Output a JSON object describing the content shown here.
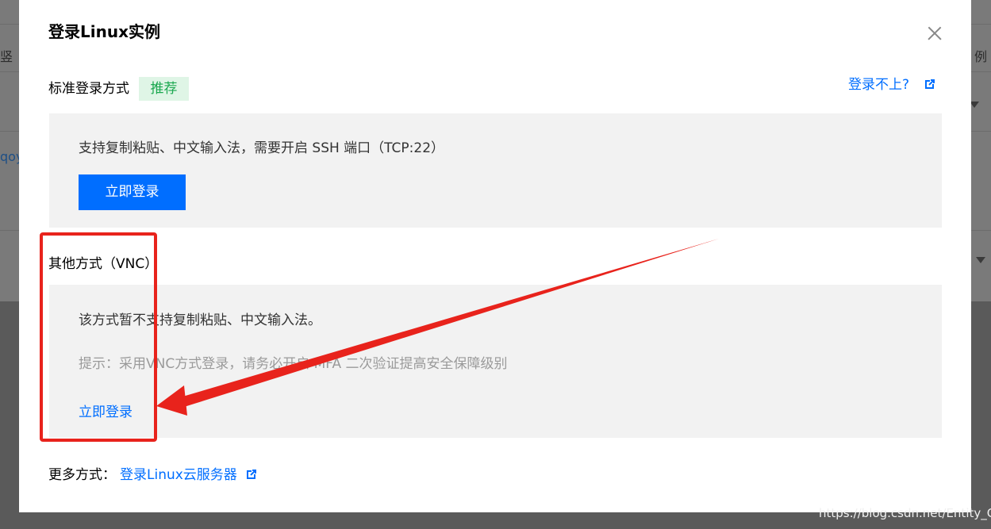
{
  "background": {
    "fragment_left_top": "竖",
    "fragment_left_mid": "qoy",
    "fragment_right_top": "例"
  },
  "modal": {
    "title": "登录Linux实例",
    "close_icon": "close-icon",
    "standard": {
      "label": "标准登录方式",
      "badge": "推荐",
      "help_link": "登录不上?",
      "help_icon": "external-link-icon",
      "description": "支持复制粘贴、中文输入法，需要开启 SSH 端口（TCP:22）",
      "login_button": "立即登录"
    },
    "other": {
      "label": "其他方式（VNC）",
      "description": "该方式暂不支持复制粘贴、中文输入法。",
      "hint": "提示：采用VNC方式登录，请务必开启 MFA 二次验证提高安全保障级别",
      "login_link": "立即登录"
    },
    "more": {
      "label": "更多方式：",
      "link": "登录Linux云服务器",
      "link_icon": "external-link-icon"
    }
  },
  "annotation": {
    "highlight_color": "#e8231c"
  },
  "watermark": "https://blog.csdn.net/Entity_G",
  "colors": {
    "primary": "#006eff",
    "badge_bg": "#dff5e6",
    "badge_text": "#1aa84f",
    "panel_bg": "#f2f2f2"
  }
}
